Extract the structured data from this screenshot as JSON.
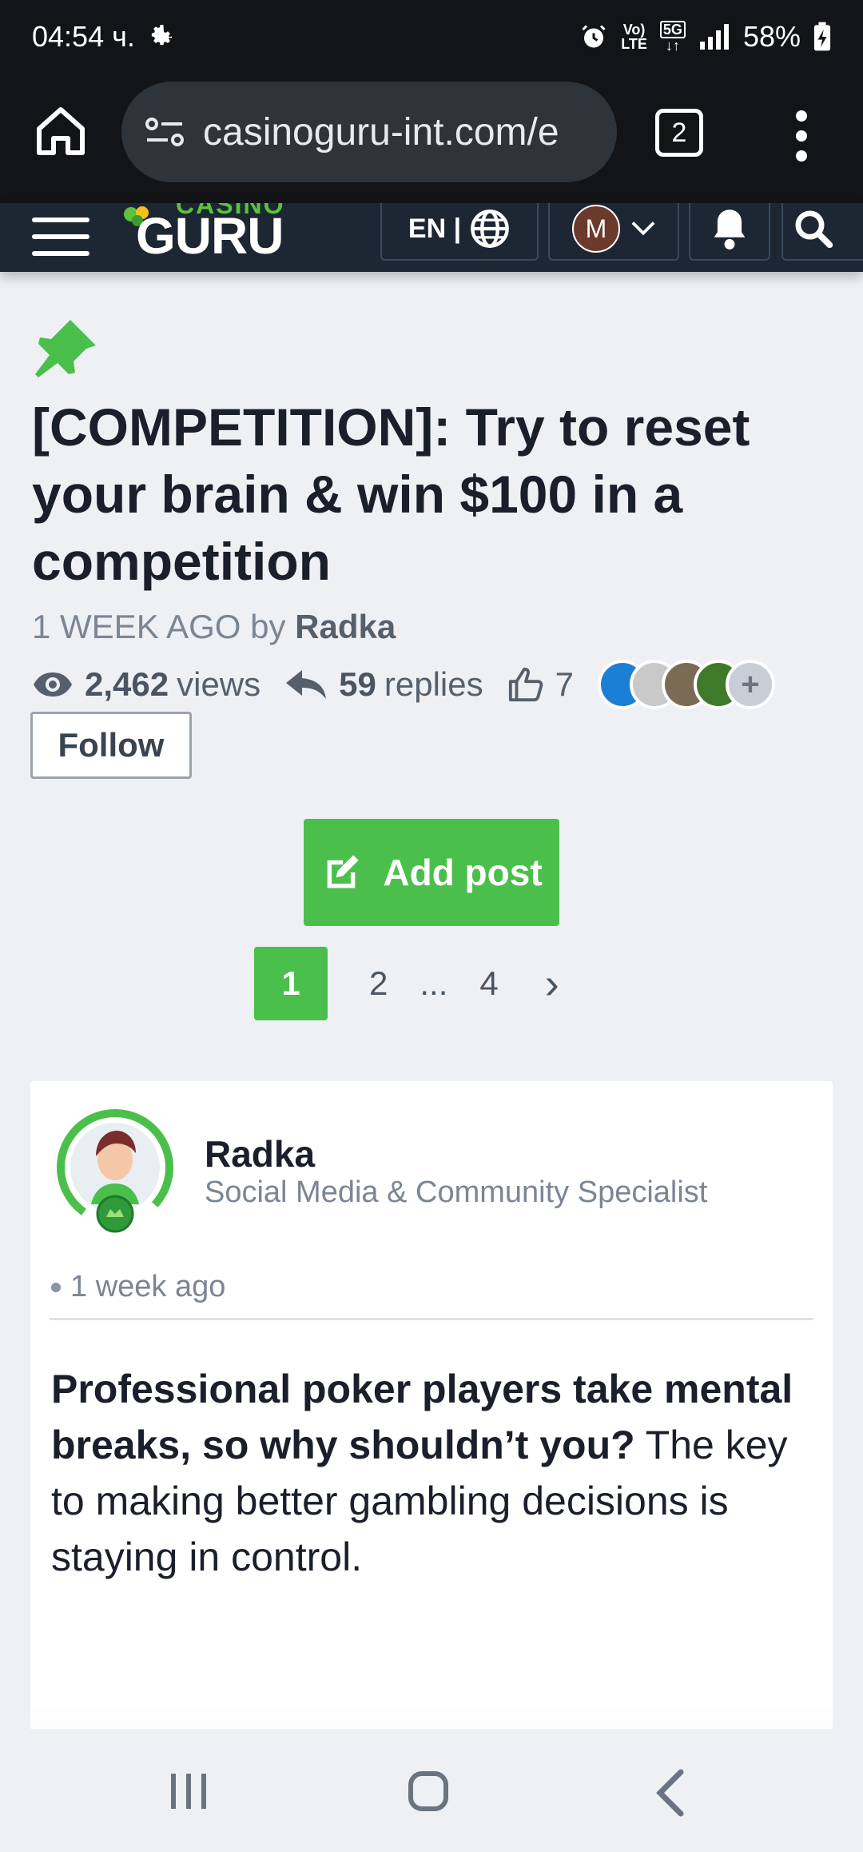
{
  "status_bar": {
    "time": "04:54 ч.",
    "volte_top": "Vo)",
    "volte_bottom": "LTE",
    "network": "5G",
    "battery": "58%"
  },
  "browser": {
    "url": "casinoguru-int.com/e",
    "tab_count": "2"
  },
  "site_header": {
    "logo_top": "CASINO",
    "logo_main": "GURU",
    "lang_label": "EN |",
    "avatar_initial": "M"
  },
  "thread": {
    "title": "[COMPETITION]: Try to reset your brain & win $100 in a competition",
    "time_ago": "1 WEEK AGO",
    "by_label": "by",
    "author": "Radka",
    "views_count": "2,462",
    "views_label": "views",
    "replies_count": "59",
    "replies_label": "replies",
    "likes_count": "7",
    "avatar_colors": [
      "#1c7fd6",
      "#c9c9c9",
      "#7b6b55",
      "#3e7a2a",
      "#c8ced6"
    ],
    "follow_label": "Follow",
    "add_post_label": "Add post"
  },
  "pagination": {
    "current": "1",
    "items": [
      "2",
      "...",
      "4"
    ],
    "next": "›"
  },
  "post": {
    "author_name": "Radka",
    "author_role": "Social Media & Community Specialist",
    "time_ago": "1 week ago",
    "body_bold": "Professional poker players take mental breaks, so why shouldn’t you?",
    "body_rest": " The key to making better gambling decisions is staying in control."
  },
  "colors": {
    "brand_green": "#4bbf4b",
    "header_dark": "#1c2733",
    "chrome_dark": "#121418"
  }
}
